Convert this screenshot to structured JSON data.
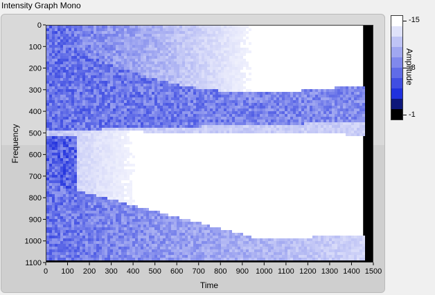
{
  "panel": {
    "title": "Intensity Graph Mono"
  },
  "colors": {
    "high": "#ffffff",
    "mid": "#1a2bdc",
    "low": "#000000",
    "frame": "#d9d9d9"
  },
  "chart_data": {
    "type": "heatmap",
    "title": "",
    "xlabel": "Time",
    "ylabel": "Frequency",
    "xlim": [
      0,
      1500
    ],
    "ylim": [
      1100,
      0
    ],
    "x_ticks": [
      "0",
      "100",
      "200",
      "300",
      "400",
      "500",
      "600",
      "700",
      "800",
      "900",
      "1000",
      "1100",
      "1200",
      "1300",
      "1400",
      "1500"
    ],
    "y_ticks": [
      "0",
      "100",
      "200",
      "300",
      "400",
      "500",
      "600",
      "700",
      "800",
      "900",
      "1000",
      "1100"
    ],
    "data_x_extent": [
      0,
      1450
    ],
    "data_y_extent": [
      0,
      1080
    ],
    "colorbar": {
      "label": "Amplitude",
      "range": [
        -1,
        -15
      ],
      "ticks": [
        "-15",
        "-8",
        "-1"
      ],
      "steps": 10,
      "colormap": "black-blue-white"
    },
    "features": [
      {
        "region": "upper band",
        "freq_range": [
          0,
          480
        ],
        "amplitude": "blue, brightening to white toward late time"
      },
      {
        "region": "central lobe",
        "freq_range": [
          480,
          900
        ],
        "amplitude": "white (high) expanding with time"
      },
      {
        "region": "low-frequency dense patch",
        "freq_range": [
          500,
          760
        ],
        "time_range": [
          0,
          130
        ],
        "amplitude": "dark blue"
      },
      {
        "region": "lower band",
        "freq_range": [
          900,
          1080
        ],
        "amplitude": "blue fading to white"
      }
    ],
    "grid": false,
    "legend": "colorbar right"
  }
}
